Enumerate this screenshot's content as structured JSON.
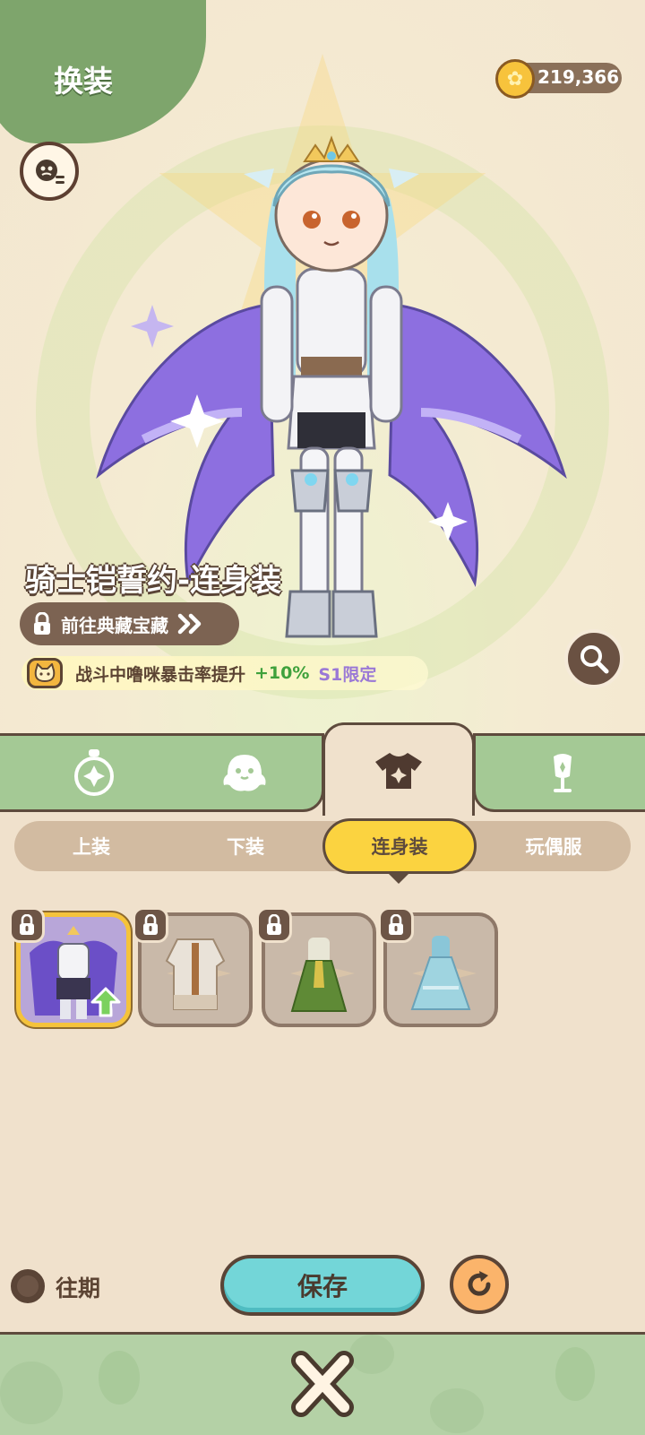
{
  "header": {
    "title": "换装",
    "coins": "219,366"
  },
  "outfit": {
    "name": "骑士铠誓约-连身装",
    "goto_label": "前往典藏宝藏",
    "bonus_text": "战斗中噜咪暴击率提升",
    "bonus_value": "+10%",
    "bonus_limit": "S1限定"
  },
  "tabs": [
    {
      "icon": "badge-icon"
    },
    {
      "icon": "ghost-icon"
    },
    {
      "icon": "shirt-icon",
      "active": true
    },
    {
      "icon": "mannequin-icon"
    }
  ],
  "subtabs": [
    {
      "label": "上装"
    },
    {
      "label": "下装"
    },
    {
      "label": "连身装",
      "active": true
    },
    {
      "label": "玩偶服"
    }
  ],
  "items": [
    {
      "name": "knight-outfit",
      "locked": true,
      "selected": true,
      "upgrade": true
    },
    {
      "name": "brown-coat-outfit",
      "locked": true
    },
    {
      "name": "green-dress-outfit",
      "locked": true
    },
    {
      "name": "blue-gown-outfit",
      "locked": true
    }
  ],
  "footer": {
    "period_label": "往期",
    "save_label": "保存"
  },
  "colors": {
    "tab_green": "#a4c995",
    "save_cyan": "#73d6d8",
    "active_yellow": "#fbd340",
    "border_brown": "#5e4b3d"
  }
}
